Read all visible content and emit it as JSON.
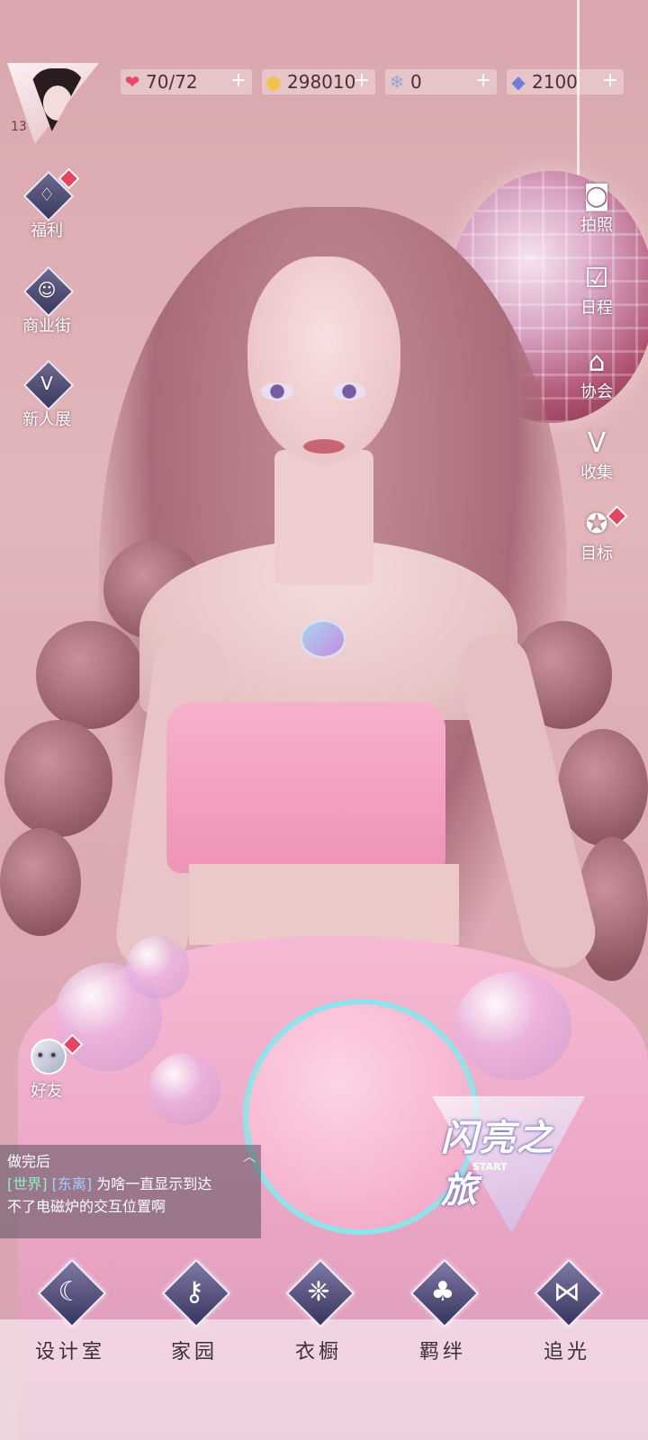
{
  "header": {
    "level": "13",
    "resources": [
      {
        "icon": "heart-gem-icon",
        "value": "70/72",
        "color": "#e8496a"
      },
      {
        "icon": "gold-coin-icon",
        "value": "298010",
        "color": "#f3c24a"
      },
      {
        "icon": "snowflake-crystal-icon",
        "value": "0",
        "color": "#8fa6d8"
      },
      {
        "icon": "diamond-icon",
        "value": "2100",
        "color": "#6b7fd8"
      }
    ]
  },
  "left_menu": [
    {
      "label": "福利",
      "icon": "hot-air-balloon-icon",
      "badge": true
    },
    {
      "label": "商业街",
      "icon": "shopping-bag-icon",
      "badge": false
    },
    {
      "label": "新人展",
      "icon": "v-badge-icon",
      "badge": false
    }
  ],
  "right_menu": [
    {
      "label": "拍照",
      "icon": "camera-icon",
      "badge": false
    },
    {
      "label": "日程",
      "icon": "calendar-check-icon",
      "badge": false
    },
    {
      "label": "协会",
      "icon": "guild-building-icon",
      "badge": false
    },
    {
      "label": "收集",
      "icon": "v-collection-icon",
      "badge": false
    },
    {
      "label": "目标",
      "icon": "target-medal-icon",
      "badge": true
    }
  ],
  "friends": {
    "label": "好友",
    "badge": true
  },
  "chat": {
    "line1": "做完后",
    "channel": "[世界]",
    "user": "[东离]",
    "message_part": "为啥一直显示到达",
    "line3": "不了电磁炉的交互位置啊"
  },
  "event": {
    "title": "闪亮之旅",
    "subtitle": "START"
  },
  "bottom_nav": [
    {
      "label": "设计室",
      "icon": "moon-design-icon"
    },
    {
      "label": "家园",
      "icon": "key-home-icon"
    },
    {
      "label": "衣橱",
      "icon": "crystal-wardrobe-icon"
    },
    {
      "label": "羁绊",
      "icon": "clover-bond-icon"
    },
    {
      "label": "追光",
      "icon": "butterfly-light-icon"
    }
  ]
}
